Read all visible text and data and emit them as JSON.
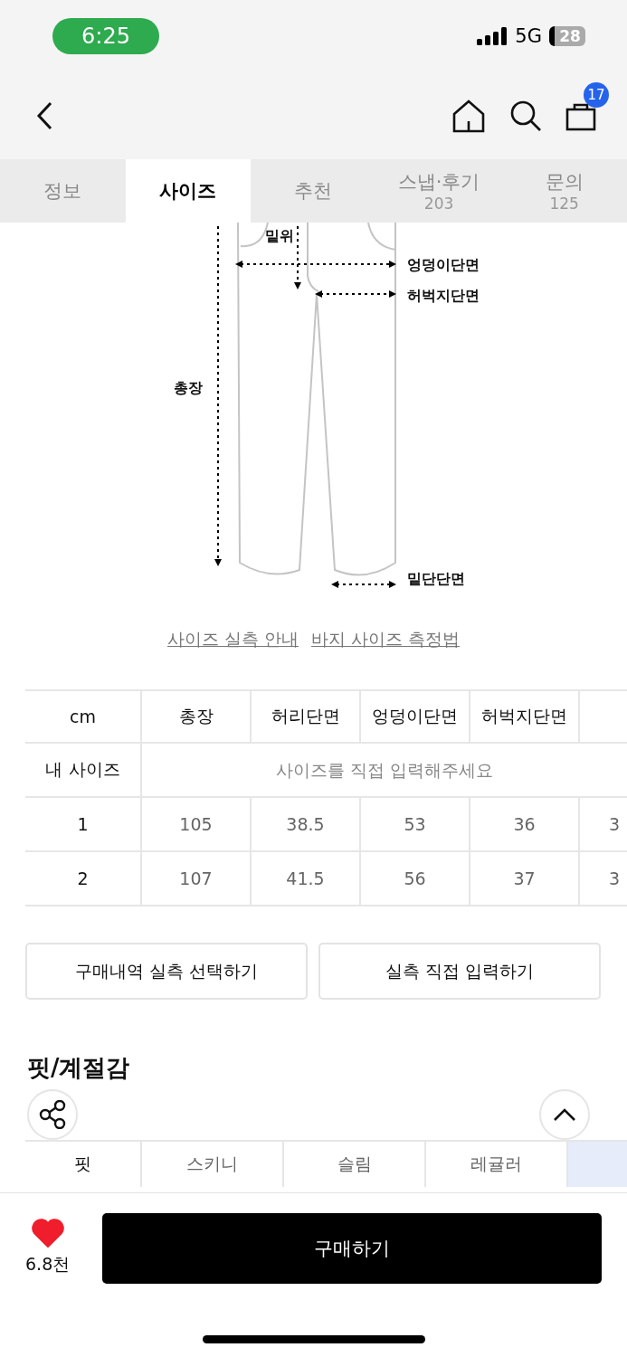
{
  "status_bar": {
    "time": "6:25",
    "network": "5G",
    "battery": "28"
  },
  "nav": {
    "cart_count": "17"
  },
  "tabs": [
    {
      "label": "정보",
      "selected": false
    },
    {
      "label": "사이즈",
      "selected": true
    },
    {
      "label": "추천",
      "selected": false
    },
    {
      "label": "스냅·후기",
      "count": "203",
      "selected": false
    },
    {
      "label": "문의",
      "count": "125",
      "selected": false
    }
  ],
  "diagram": {
    "labels": [
      "밑위",
      "엉덩이단면",
      "허벅지단면",
      "총장",
      "밑단단면"
    ]
  },
  "links": [
    "사이즈 실측 안내",
    "바지 사이즈 측정법"
  ],
  "size_table": {
    "columns": [
      "cm",
      "총장",
      "허리단면",
      "엉덩이단면",
      "허벅지단면"
    ],
    "my_size": {
      "label": "내 사이즈",
      "placeholder": "사이즈를 직접 입력해주세요"
    },
    "rows": [
      {
        "label": "1",
        "values": [
          "105",
          "38.5",
          "53",
          "36",
          "3"
        ]
      },
      {
        "label": "2",
        "values": [
          "107",
          "41.5",
          "56",
          "37",
          "3"
        ]
      }
    ]
  },
  "actions": [
    "구매내역 실측 선택하기",
    "실측 직접 입력하기"
  ],
  "fit": {
    "title": "핏/계절감",
    "row_label": "핏",
    "options": [
      {
        "label": "스키니",
        "selected": false
      },
      {
        "label": "슬림",
        "selected": false
      },
      {
        "label": "레귤러",
        "selected": false
      },
      {
        "selected": true
      }
    ]
  },
  "bottom_bar": {
    "likes": "6.8천",
    "liked": true,
    "buy": "구매하기"
  }
}
